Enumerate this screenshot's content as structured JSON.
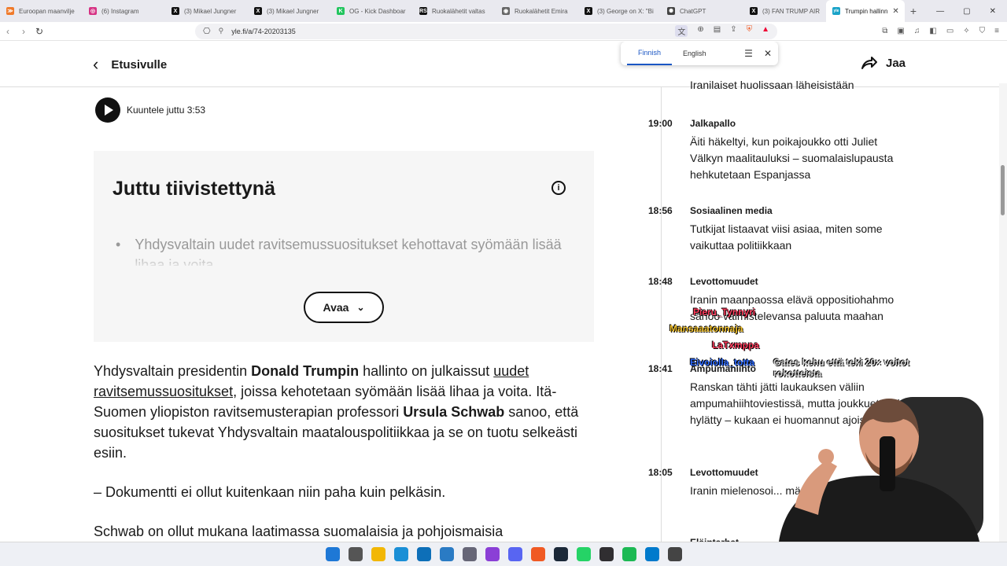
{
  "browser": {
    "tabs": [
      {
        "label": "Euroopan maanvilje",
        "color": "#f07a2a",
        "glyph": "≫"
      },
      {
        "label": "(6) Instagram",
        "color": "#d63384",
        "glyph": "◎"
      },
      {
        "label": "(3) Mikael Jungner",
        "color": "#111111",
        "glyph": "X"
      },
      {
        "label": "(3) Mikael Jungner",
        "color": "#111111",
        "glyph": "X"
      },
      {
        "label": "OG - Kick Dashboar",
        "color": "#22c55e",
        "glyph": "K"
      },
      {
        "label": "Ruokalähetit valtas",
        "color": "#111111",
        "glyph": "RS"
      },
      {
        "label": "Ruokalähetit Emira",
        "color": "#666666",
        "glyph": "◉"
      },
      {
        "label": "(3) George on X: \"Bi",
        "color": "#111111",
        "glyph": "X"
      },
      {
        "label": "ChatGPT",
        "color": "#444444",
        "glyph": "✺"
      },
      {
        "label": "(3) FAN TRUMP AIR",
        "color": "#111111",
        "glyph": "X"
      }
    ],
    "active_tab": {
      "label": "Trumpin hallinn",
      "color": "#1aa3c8",
      "glyph": "yle"
    },
    "url": "yle.fi/a/74-20203135"
  },
  "translate": {
    "lang1": "Finnish",
    "lang2": "English"
  },
  "header": {
    "back_label": "Etusivulle",
    "share_label": "Jaa"
  },
  "listen": {
    "label": "Kuuntele juttu 3:53"
  },
  "summary": {
    "title": "Juttu tiivistettynä",
    "bullet": "Yhdysvaltain uudet ravitsemussuositukset kehottavat syömään lisää lihaa ja voita",
    "open_label": "Avaa"
  },
  "article": {
    "p1_a": "Yhdysvaltain presidentin ",
    "p1_b": "Donald Trumpin",
    "p1_c": " hallinto on julkaissut ",
    "p1_link": "uudet ravitsemussuositukset",
    "p1_d": ", joissa kehotetaan syömään lisää lihaa ja voita. Itä-Suomen yliopiston ravitsemusterapian professori ",
    "p1_e": "Ursula Schwab",
    "p1_f": " sanoo, että suositukset tukevat Yhdysvaltain maatalouspolitiikkaa ja se on tuotu selkeästi esiin.",
    "p2": "– Dokumentti ei ollut kuitenkaan niin paha kuin pelkäsin.",
    "p3": "Schwab on ollut mukana laatimassa suomalaisia ja pohjoismaisia"
  },
  "feed": {
    "top_partial": "Iranilaiset huolissaan läheisistään",
    "items": [
      {
        "time": "19:00",
        "category": "Jalkapallo",
        "headline": "Äiti häkeltyi, kun poikajoukko otti Juliet Välkyn maalitauluksi – suomalaislupausta hehkutetaan Espanjassa"
      },
      {
        "time": "18:56",
        "category": "Sosiaalinen media",
        "headline": "Tutkijat listaavat viisi asiaa, miten some vaikuttaa politiikkaan"
      },
      {
        "time": "18:48",
        "category": "Levottomuudet",
        "headline": "Iranin maanpaossa elävä oppositiohahmo sanoo valmistelevansa paluuta maahan"
      },
      {
        "time": "18:41",
        "category": "Ampumahiihto",
        "headline": "Ranskan tähti jätti laukauksen väliin ampumahiihtoviestissä, mutta joukkuetta ei hylätty – kukaan ei huomannut ajoissa"
      },
      {
        "time": "18:05",
        "category": "Levottomuudet",
        "headline": "Iranin mielenosoi... määrä voi noust..."
      },
      {
        "time": "",
        "category": "Eläintarhat",
        "headline": ""
      }
    ]
  },
  "overlay_chat": [
    {
      "name": "Pieru_Tynnyri"
    },
    {
      "name": "Mansaaatonnaja"
    },
    {
      "name": "LaTxmppa"
    },
    {
      "name": "Eivoiolla_totta",
      "message": "Gates kehu että teki 20× voitot rokotteista"
    }
  ],
  "taskbar": [
    "windows",
    "search",
    "files",
    "edge",
    "store",
    "vscode",
    "settings",
    "podcast",
    "discord",
    "brave",
    "steam",
    "whatsapp",
    "obs",
    "spotify",
    "code",
    "calculator"
  ]
}
